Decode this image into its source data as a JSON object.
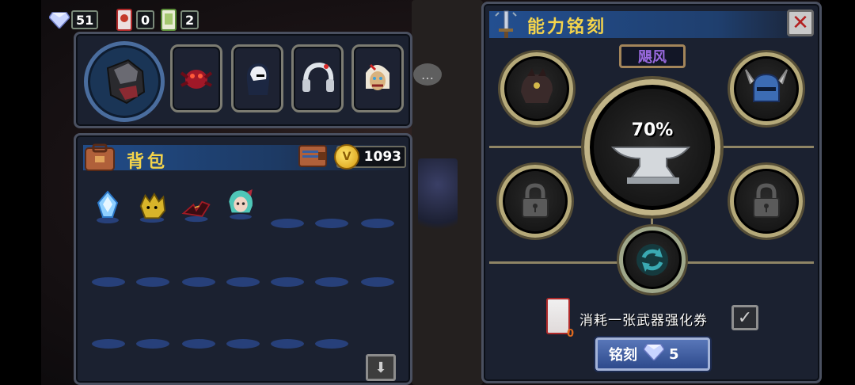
{
  "currencies": [
    {
      "name": "gem-icon",
      "value": "51"
    },
    {
      "name": "weapon-ticket-icon",
      "value": "0"
    },
    {
      "name": "card-ticket-icon",
      "value": "2"
    }
  ],
  "backpack": {
    "title": "背包",
    "coins": "1093",
    "coin_symbol": "V"
  },
  "engrave_panel": {
    "title": "能力铭刻",
    "close_label": "✕",
    "tag": "飓风",
    "percent": "70%",
    "consume_text": "消耗一张武器强化券",
    "ticket_count": "0",
    "check_symbol": "✓",
    "button_label": "铭刻",
    "button_cost": "5"
  },
  "colors": {
    "accent_yellow": "#f4d44b",
    "panel_bg": "#1b2130",
    "header_blue": "#214c88",
    "tag_purple": "#9a6ae0",
    "button_blue": "#4462a2"
  }
}
